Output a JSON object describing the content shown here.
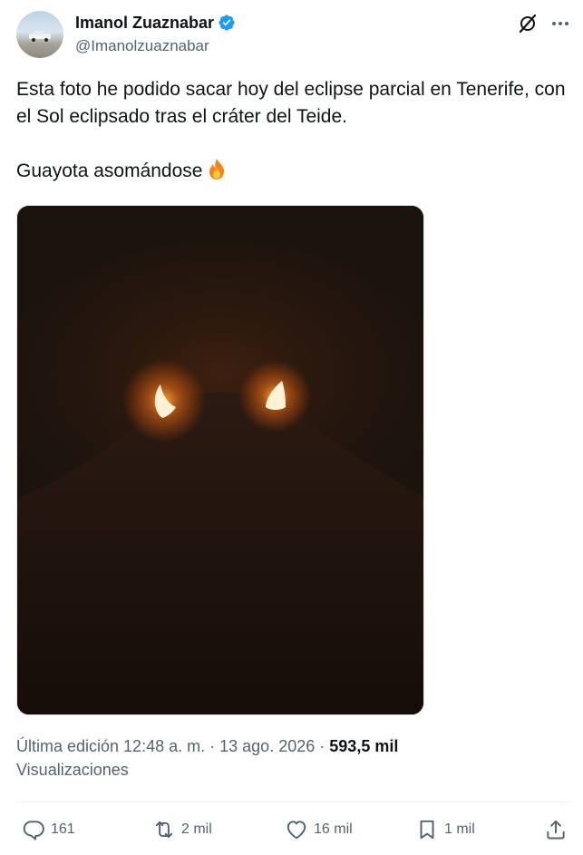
{
  "author": {
    "name": "Imanol Zuaznabar",
    "handle": "@Imanolzuaznabar",
    "verified_icon": "verified-badge-icon"
  },
  "header_icons": [
    "grok-icon",
    "more-options-icon"
  ],
  "tweet": {
    "line1": "Esta foto he podido sacar hoy del eclipse parcial en Tenerife, con el Sol eclipsado tras el cráter del Teide.",
    "line2": "Guayota asomándose",
    "emoji": "fire-emoji"
  },
  "media": {
    "kind": "photo",
    "colors": {
      "sky": "#1b120d",
      "glow": "#ff7a1a",
      "core": "#fff3d6"
    }
  },
  "meta": {
    "edited_label": "Última edición 12:48 a. m.",
    "separator1": "·",
    "date": "13 ago. 2026",
    "separator2": "·",
    "views_count": "593,5 mil",
    "views_label": "Visualizaciones"
  },
  "actions": {
    "replies": "161",
    "reposts": "2 mil",
    "likes": "16 mil",
    "bookmarks": "1 mil",
    "share_icon": "share-icon"
  },
  "colors": {
    "text_primary": "#0f1419",
    "text_secondary": "#536471",
    "verified_blue": "#1d9bf0",
    "divider": "#eff3f4"
  }
}
